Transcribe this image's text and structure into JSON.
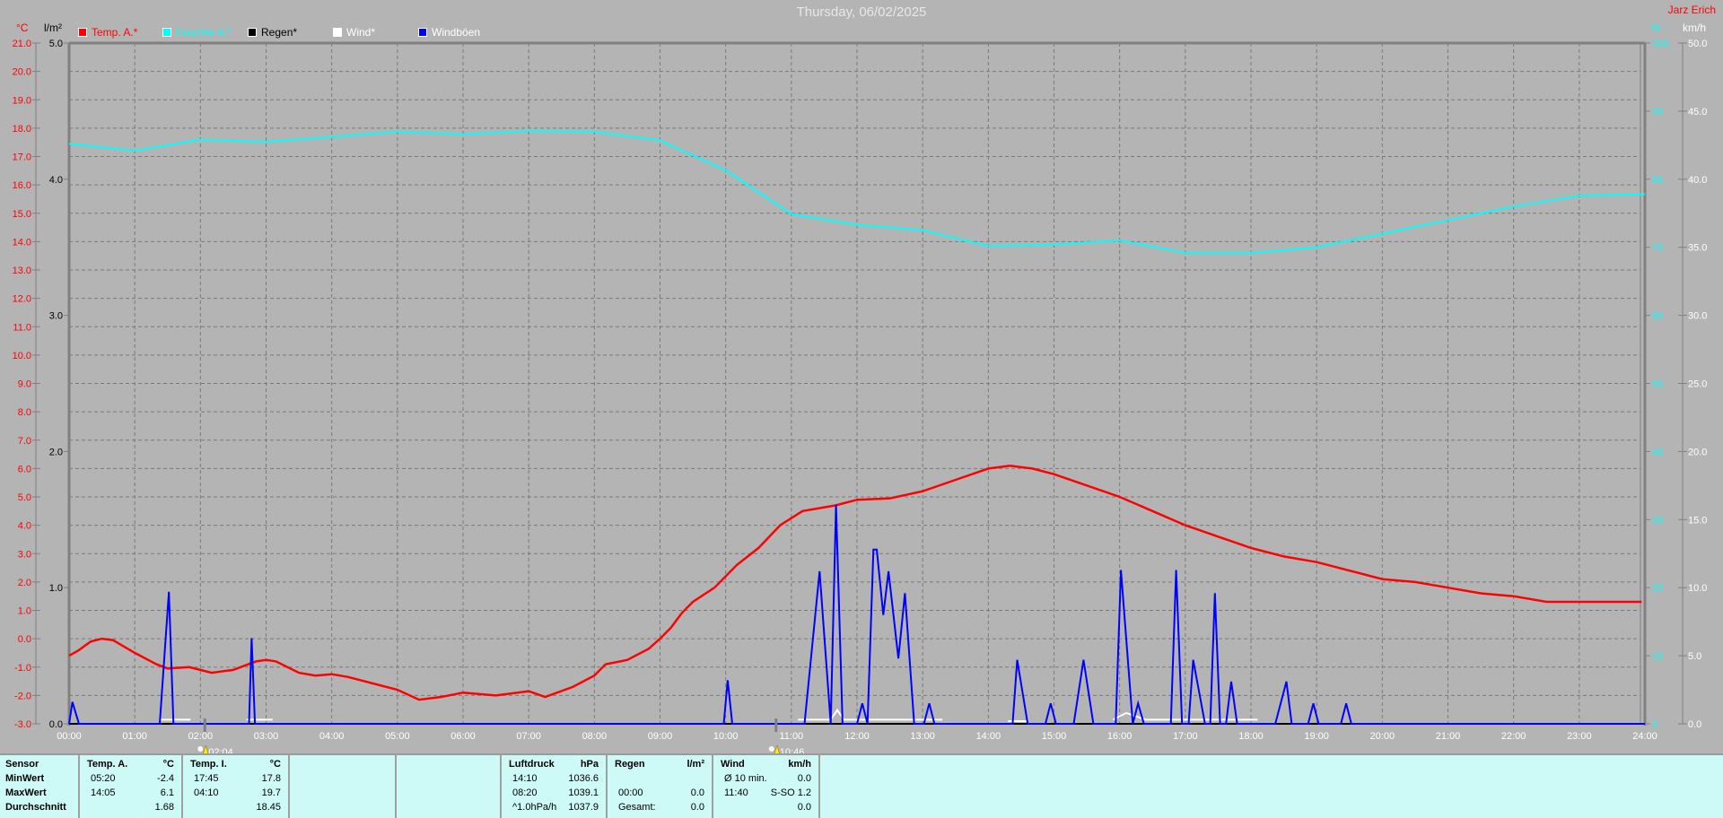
{
  "header": {
    "title": "Thursday, 06/02/2025",
    "author": "Jarz Erich"
  },
  "chart_data": {
    "type": "line",
    "title": "Thursday, 06/02/2025",
    "x_ticks": [
      "00:00",
      "01:00",
      "02:00",
      "03:00",
      "04:00",
      "05:00",
      "06:00",
      "07:00",
      "08:00",
      "09:00",
      "10:00",
      "11:00",
      "12:00",
      "13:00",
      "14:00",
      "15:00",
      "16:00",
      "17:00",
      "18:00",
      "19:00",
      "20:00",
      "21:00",
      "22:00",
      "23:00",
      "24:00"
    ],
    "xlim_hours": [
      0,
      24
    ],
    "grid": true,
    "legend_position": "top-left",
    "axes": {
      "temp": {
        "unit": "°C",
        "ylim": [
          -3.0,
          21.0
        ],
        "ticks": [
          "21.0",
          "20.0",
          "19.0",
          "18.0",
          "17.0",
          "16.0",
          "15.0",
          "14.0",
          "13.0",
          "12.0",
          "11.0",
          "10.0",
          "9.0",
          "8.0",
          "7.0",
          "6.0",
          "5.0",
          "4.0",
          "3.0",
          "2.0",
          "1.0",
          "0.0",
          "-1.0",
          "-2.0",
          "-3.0"
        ],
        "color": "#ff0000"
      },
      "rain": {
        "unit": "l/m²",
        "ylim": [
          0,
          5
        ],
        "ticks": [
          "5.0",
          "4.0",
          "3.0",
          "2.0",
          "1.0",
          "0.0"
        ],
        "color": "#000000"
      },
      "humidity": {
        "unit": "%",
        "ylim": [
          0,
          100
        ],
        "ticks": [
          "100",
          "90",
          "80",
          "70",
          "60",
          "50",
          "40",
          "30",
          "20",
          "10",
          "0"
        ],
        "color": "#00ffff"
      },
      "wind": {
        "unit": "km/h",
        "ylim": [
          0,
          50
        ],
        "ticks": [
          "50.0",
          "45.0",
          "40.0",
          "35.0",
          "30.0",
          "25.0",
          "20.0",
          "15.0",
          "10.0",
          "5.0",
          "0.0"
        ],
        "color": "#ffffff"
      }
    },
    "series": [
      {
        "name": "Temp. A.*",
        "axis": "temp",
        "color": "#ff0000",
        "points": [
          [
            0,
            -0.6
          ],
          [
            0.15,
            -0.4
          ],
          [
            0.33,
            -0.1
          ],
          [
            0.5,
            0.0
          ],
          [
            0.67,
            -0.05
          ],
          [
            1.0,
            -0.5
          ],
          [
            1.33,
            -0.9
          ],
          [
            1.5,
            -1.05
          ],
          [
            1.83,
            -1.0
          ],
          [
            2.0,
            -1.1
          ],
          [
            2.17,
            -1.2
          ],
          [
            2.5,
            -1.1
          ],
          [
            2.67,
            -0.95
          ],
          [
            2.85,
            -0.8
          ],
          [
            3.0,
            -0.75
          ],
          [
            3.15,
            -0.8
          ],
          [
            3.5,
            -1.2
          ],
          [
            3.75,
            -1.3
          ],
          [
            4.0,
            -1.25
          ],
          [
            4.25,
            -1.35
          ],
          [
            4.5,
            -1.5
          ],
          [
            5.0,
            -1.8
          ],
          [
            5.33,
            -2.15
          ],
          [
            5.67,
            -2.05
          ],
          [
            6.0,
            -1.9
          ],
          [
            6.5,
            -2.0
          ],
          [
            7.0,
            -1.85
          ],
          [
            7.25,
            -2.05
          ],
          [
            7.67,
            -1.7
          ],
          [
            8.0,
            -1.3
          ],
          [
            8.17,
            -0.9
          ],
          [
            8.5,
            -0.75
          ],
          [
            8.83,
            -0.35
          ],
          [
            9.0,
            0.0
          ],
          [
            9.17,
            0.4
          ],
          [
            9.33,
            0.9
          ],
          [
            9.5,
            1.3
          ],
          [
            9.83,
            1.8
          ],
          [
            10.17,
            2.6
          ],
          [
            10.5,
            3.2
          ],
          [
            10.83,
            4.0
          ],
          [
            11.17,
            4.5
          ],
          [
            11.67,
            4.7
          ],
          [
            12.0,
            4.9
          ],
          [
            12.5,
            4.95
          ],
          [
            13.0,
            5.2
          ],
          [
            13.5,
            5.6
          ],
          [
            14.0,
            6.0
          ],
          [
            14.33,
            6.1
          ],
          [
            14.67,
            6.0
          ],
          [
            15.0,
            5.8
          ],
          [
            15.5,
            5.4
          ],
          [
            16.0,
            5.0
          ],
          [
            16.5,
            4.5
          ],
          [
            17.0,
            4.0
          ],
          [
            17.5,
            3.6
          ],
          [
            18.0,
            3.2
          ],
          [
            18.5,
            2.9
          ],
          [
            19.0,
            2.7
          ],
          [
            19.5,
            2.4
          ],
          [
            20.0,
            2.1
          ],
          [
            20.5,
            2.0
          ],
          [
            21.0,
            1.8
          ],
          [
            21.5,
            1.6
          ],
          [
            22.0,
            1.5
          ],
          [
            22.5,
            1.3
          ],
          [
            23.0,
            1.3
          ],
          [
            23.95,
            1.3
          ]
        ]
      },
      {
        "name": "Feuchte A.*",
        "axis": "humidity",
        "color": "#00ffff",
        "points": [
          [
            0,
            85.2
          ],
          [
            1,
            84.2
          ],
          [
            2,
            85.8
          ],
          [
            3,
            85.5
          ],
          [
            4,
            86.2
          ],
          [
            5,
            87.0
          ],
          [
            6,
            86.6
          ],
          [
            7,
            87.1
          ],
          [
            8,
            87.0
          ],
          [
            9,
            85.7
          ],
          [
            10,
            81.3
          ],
          [
            11,
            74.9
          ],
          [
            12,
            73.3
          ],
          [
            13,
            72.5
          ],
          [
            14,
            70.2
          ],
          [
            15,
            70.4
          ],
          [
            16,
            71.0
          ],
          [
            17,
            69.2
          ],
          [
            18,
            69.2
          ],
          [
            19,
            70.0
          ],
          [
            20,
            72.0
          ],
          [
            21,
            74.0
          ],
          [
            22,
            76.0
          ],
          [
            23,
            77.6
          ],
          [
            24,
            77.8
          ]
        ]
      },
      {
        "name": "Regen*",
        "axis": "rain",
        "color": "#000000",
        "points": [
          [
            0,
            0
          ],
          [
            24,
            0
          ]
        ]
      },
      {
        "name": "Wind*",
        "axis": "wind",
        "color": "#ffffff",
        "segments": [
          [
            [
              1.38,
              0.3
            ],
            [
              1.85,
              0.3
            ]
          ],
          [
            [
              2.7,
              0.3
            ],
            [
              3.1,
              0.3
            ]
          ],
          [
            [
              11.1,
              0.3
            ],
            [
              11.6,
              0.3
            ],
            [
              11.7,
              1.0
            ],
            [
              11.8,
              0.3
            ],
            [
              13.3,
              0.3
            ]
          ],
          [
            [
              14.3,
              0.2
            ],
            [
              14.6,
              0.2
            ]
          ],
          [
            [
              15.9,
              0.3
            ],
            [
              16.1,
              0.8
            ],
            [
              16.4,
              0.3
            ],
            [
              17.6,
              0.3
            ],
            [
              18.1,
              0.3
            ]
          ]
        ]
      },
      {
        "name": "Windböen",
        "axis": "wind",
        "color": "#0000ff",
        "points": [
          [
            0,
            0
          ],
          [
            0.05,
            1.6
          ],
          [
            0.15,
            0
          ],
          [
            1.38,
            0
          ],
          [
            1.52,
            9.7
          ],
          [
            1.59,
            0
          ],
          [
            2.74,
            0
          ],
          [
            2.78,
            6.3
          ],
          [
            2.83,
            0
          ],
          [
            9.97,
            0
          ],
          [
            10.03,
            3.2
          ],
          [
            10.1,
            0
          ],
          [
            11.2,
            0
          ],
          [
            11.43,
            11.2
          ],
          [
            11.6,
            0
          ],
          [
            11.68,
            16.1
          ],
          [
            11.78,
            0
          ],
          [
            12.0,
            0
          ],
          [
            12.08,
            1.5
          ],
          [
            12.16,
            0
          ],
          [
            12.16,
            0
          ],
          [
            12.25,
            12.8
          ],
          [
            12.3,
            12.8
          ],
          [
            12.4,
            8.0
          ],
          [
            12.48,
            11.2
          ],
          [
            12.63,
            4.8
          ],
          [
            12.73,
            9.6
          ],
          [
            12.87,
            0
          ],
          [
            13.02,
            0
          ],
          [
            13.1,
            1.5
          ],
          [
            13.18,
            0
          ],
          [
            14.37,
            0
          ],
          [
            14.44,
            4.7
          ],
          [
            14.6,
            0
          ],
          [
            14.87,
            0
          ],
          [
            14.95,
            1.5
          ],
          [
            15.03,
            0
          ],
          [
            15.3,
            0
          ],
          [
            15.45,
            4.7
          ],
          [
            15.6,
            0
          ],
          [
            15.94,
            0
          ],
          [
            16.02,
            11.3
          ],
          [
            16.2,
            0
          ],
          [
            16.28,
            1.5
          ],
          [
            16.37,
            0
          ],
          [
            16.78,
            0
          ],
          [
            16.86,
            11.3
          ],
          [
            16.95,
            0
          ],
          [
            17.05,
            0
          ],
          [
            17.12,
            4.7
          ],
          [
            17.3,
            0
          ],
          [
            17.38,
            0
          ],
          [
            17.45,
            9.6
          ],
          [
            17.53,
            0
          ],
          [
            17.62,
            0
          ],
          [
            17.7,
            3.1
          ],
          [
            17.79,
            0
          ],
          [
            18.37,
            0
          ],
          [
            18.54,
            3.1
          ],
          [
            18.62,
            0
          ],
          [
            18.87,
            0
          ],
          [
            18.95,
            1.5
          ],
          [
            19.03,
            0
          ],
          [
            19.37,
            0
          ],
          [
            19.45,
            1.5
          ],
          [
            19.53,
            0
          ],
          [
            24,
            0
          ]
        ]
      }
    ],
    "markers": [
      {
        "time_hours": 2.067,
        "label": "02:04"
      },
      {
        "time_hours": 10.767,
        "label": "10:46"
      }
    ]
  },
  "stats": {
    "cols": [
      {
        "lines": [
          [
            "Sensor",
            ""
          ],
          [
            "MinWert",
            ""
          ],
          [
            "MaxWert",
            ""
          ],
          [
            "Durchschnitt",
            ""
          ]
        ]
      },
      {
        "lines": [
          [
            "Temp. A.",
            "°C"
          ],
          [
            "05:20",
            "-2.4"
          ],
          [
            "14:05",
            "6.1"
          ],
          [
            "",
            "1.68"
          ]
        ]
      },
      {
        "lines": [
          [
            "Temp. I.",
            "°C"
          ],
          [
            "17:45",
            "17.8"
          ],
          [
            "04:10",
            "19.7"
          ],
          [
            "",
            "18.45"
          ]
        ]
      },
      {
        "lines": [
          [
            "",
            ""
          ],
          [
            "",
            ""
          ],
          [
            "",
            ""
          ],
          [
            "",
            ""
          ]
        ]
      },
      {
        "lines": [
          [
            "",
            ""
          ],
          [
            "",
            ""
          ],
          [
            "",
            ""
          ],
          [
            "",
            ""
          ]
        ]
      },
      {
        "lines": [
          [
            "Luftdruck",
            "hPa"
          ],
          [
            "14:10",
            "1036.6"
          ],
          [
            "08:20",
            "1039.1"
          ],
          [
            "^1.0hPa/h",
            "1037.9"
          ]
        ]
      },
      {
        "lines": [
          [
            "Regen",
            "l/m²"
          ],
          [
            "",
            ""
          ],
          [
            "00:00",
            "0.0"
          ],
          [
            "Gesamt:",
            "0.0"
          ]
        ]
      },
      {
        "lines": [
          [
            "Wind",
            "km/h"
          ],
          [
            "Ø 10 min.",
            "0.0"
          ],
          [
            "11:40",
            "S-SO 1.2"
          ],
          [
            "",
            "0.0"
          ]
        ]
      }
    ]
  }
}
